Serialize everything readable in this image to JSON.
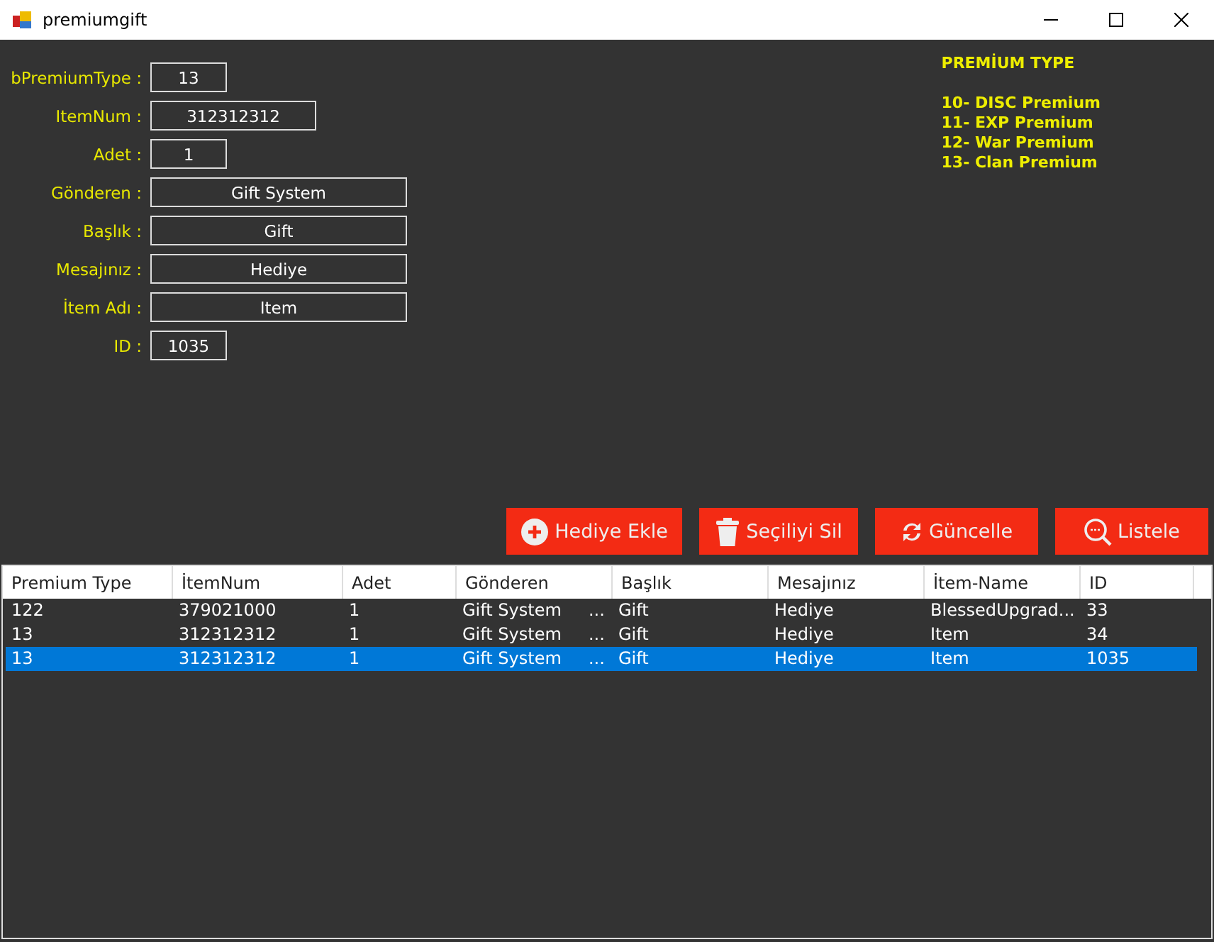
{
  "window": {
    "title": "premiumgift"
  },
  "form": [
    {
      "label": "bPremiumType :",
      "value": "13"
    },
    {
      "label": "ItemNum :",
      "value": "312312312"
    },
    {
      "label": "Adet :",
      "value": "1"
    },
    {
      "label": "Gönderen :",
      "value": "Gift System"
    },
    {
      "label": "Başlık :",
      "value": "Gift"
    },
    {
      "label": "Mesajınız :",
      "value": "Hediye"
    },
    {
      "label": "İtem Adı :",
      "value": "Item"
    },
    {
      "label": "ID :",
      "value": "1035"
    }
  ],
  "legend": {
    "title": "PREMİUM TYPE",
    "lines": [
      "10- DISC Premium",
      "11- EXP Premium",
      "12- War Premium",
      "13- Clan Premium"
    ]
  },
  "buttons": [
    {
      "label": "Hediye Ekle",
      "kind": "add"
    },
    {
      "label": "Seçiliyi Sil",
      "kind": "delete"
    },
    {
      "label": "Güncelle",
      "kind": "refresh"
    },
    {
      "label": "Listele",
      "kind": "search"
    }
  ],
  "table": {
    "columns": [
      "Premium Type",
      "İtemNum",
      "Adet",
      "Gönderen",
      "Başlık",
      "Mesajınız",
      "İtem-Name",
      "ID"
    ],
    "rows": [
      {
        "cells": [
          "122",
          "379021000",
          "1",
          "Gift System     ...",
          "Gift",
          "Hediye",
          "BlessedUpgrad...",
          "33"
        ],
        "selected": false
      },
      {
        "cells": [
          "13",
          "312312312",
          "1",
          "Gift System     ...",
          "Gift",
          "Hediye",
          "Item",
          "34"
        ],
        "selected": false
      },
      {
        "cells": [
          "13",
          "312312312",
          "1",
          "Gift System     ...",
          "Gift",
          "Hediye",
          "Item",
          "1035"
        ],
        "selected": true
      }
    ]
  }
}
